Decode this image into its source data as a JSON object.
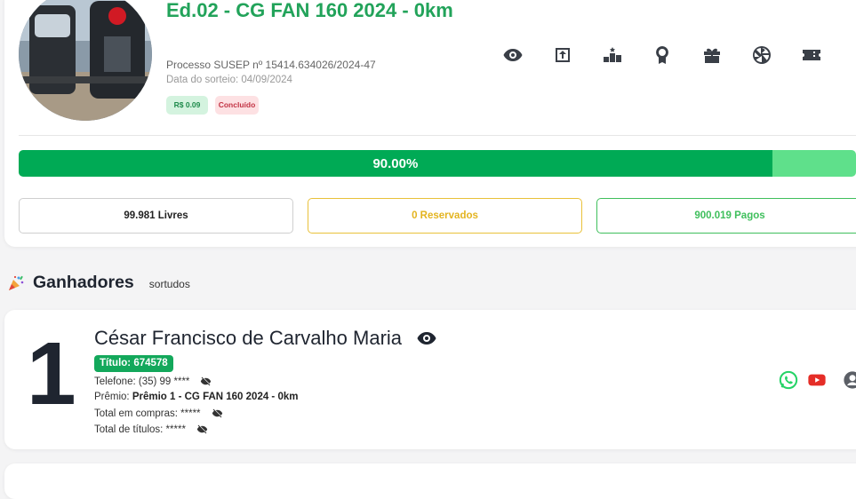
{
  "draw": {
    "title": "Ed.02 - CG FAN 160 2024 - 0km",
    "susep": "Processo SUSEP nº 15414.634026/2024-47",
    "date": "Data do sorteio: 04/09/2024",
    "price_badge": "R$ 0.09",
    "status_badge": "Concluído",
    "progress_label": "90.00%",
    "progress_fraction": 0.9,
    "stats": {
      "free": "99.981 Livres",
      "reserved": "0 Reservados",
      "paid": "900.019 Pagos"
    }
  },
  "toolbar_icons": [
    "eye-icon",
    "share-icon",
    "ranking-icon",
    "award-icon",
    "gift-icon",
    "wheel-icon",
    "ticket-icon",
    "more-icon"
  ],
  "winners": {
    "heading": "Ganhadores",
    "subheading": "sortudos",
    "items": [
      {
        "rank": "1",
        "name": "César Francisco de Carvalho Maria",
        "ticket": "Título: 674578",
        "phone": "Telefone: (35) 99 ****",
        "prize_label": "Prêmio:",
        "prize_value": "Prêmio 1 - CG FAN 160 2024 - 0km",
        "total_purchases": "Total em compras: *****",
        "total_tickets": "Total de títulos: *****"
      }
    ]
  },
  "colors": {
    "brand_green": "#22a35a",
    "progress_fill": "#00aa55",
    "progress_track": "#5fe08b",
    "reserved": "#e3b420",
    "paid": "#3fbf5c",
    "whatsapp": "#25d366",
    "youtube": "#e52d27"
  }
}
